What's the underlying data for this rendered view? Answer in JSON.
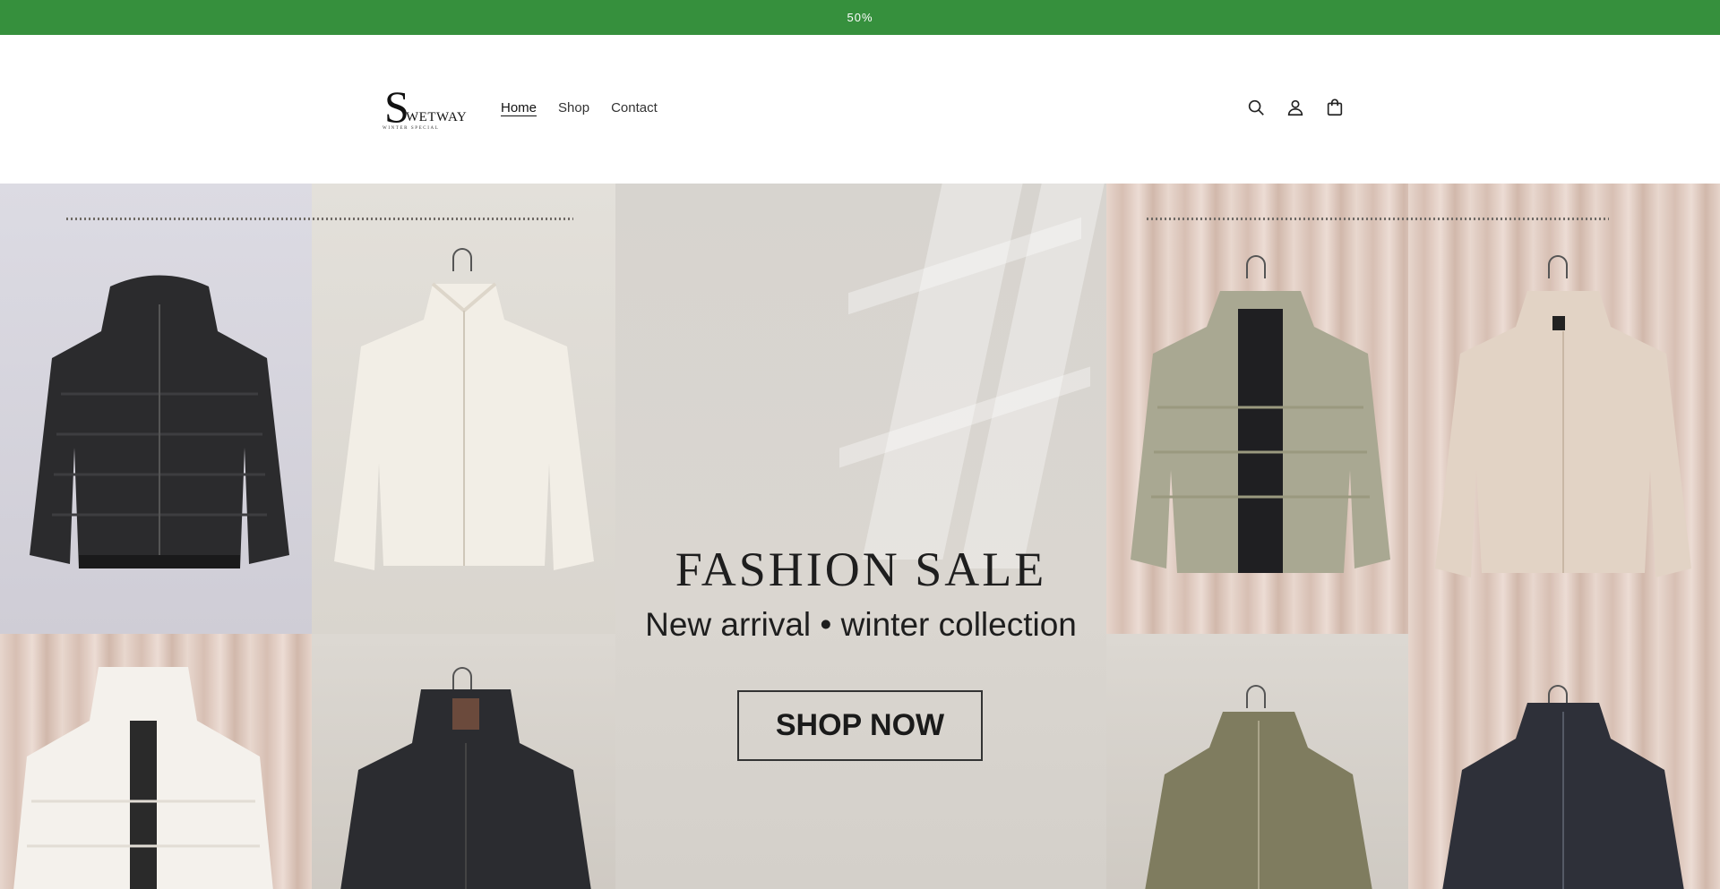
{
  "announcement": {
    "text": "50%"
  },
  "brand": {
    "initial": "S",
    "name": "WETWAY",
    "tagline": "WINTER SPECIAL"
  },
  "nav": {
    "items": [
      "Home",
      "Shop",
      "Contact"
    ],
    "active": "Home"
  },
  "header_icons": [
    "search-icon",
    "account-icon",
    "cart-icon"
  ],
  "hero": {
    "title": "FASHION SALE",
    "subtitle": "New arrival • winter collection",
    "cta": "SHOP NOW"
  },
  "colors": {
    "announcement_bg": "#36903d",
    "announcement_text": "#ffffff",
    "text": "#121212"
  }
}
